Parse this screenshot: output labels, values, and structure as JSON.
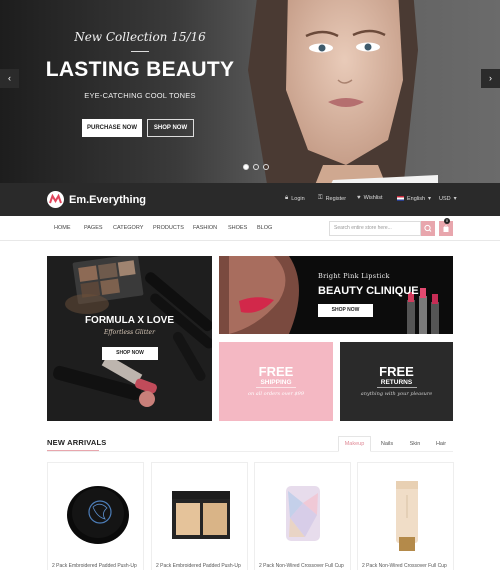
{
  "hero": {
    "subtitle": "New Collection 15/16",
    "title": "LASTING BEAUTY",
    "tagline": "EYE-CATCHING COOL TONES",
    "purchase_label": "PURCHASE NOW",
    "shop_label": "SHOP NOW",
    "prev_arrow": "‹",
    "next_arrow": "›",
    "slides": 3,
    "active_slide": 1
  },
  "topbar": {
    "brand": "Em.Everything",
    "login": "Login",
    "register": "Register",
    "wishlist": "Wishlist",
    "language": "English",
    "currency": "USD"
  },
  "nav": {
    "items": [
      "HOME",
      "PAGES",
      "CATEGORY",
      "PRODUCTS",
      "FASHION",
      "SHOES",
      "BLOG"
    ],
    "search_placeholder": "Search entire store here...",
    "cart_count": "0"
  },
  "banners": {
    "formula": {
      "title": "FORMULA X LOVE",
      "subtitle": "Effortless Glitter",
      "button": "SHOP NOW"
    },
    "lipstick": {
      "subtitle": "Bright Pink Lipstick",
      "title": "BEAUTY CLINIQUE",
      "button": "SHOP NOW"
    },
    "shipping": {
      "title": "FREE",
      "subtitle": "SHIPPING",
      "desc": "on all orders over $99"
    },
    "returns": {
      "title": "FREE",
      "subtitle": "RETURNS",
      "desc": "anything with your pleasure"
    }
  },
  "arrivals": {
    "title": "NEW ARRIVALS",
    "tabs": [
      "Makeup",
      "Nails",
      "Skin",
      "Hair"
    ],
    "active_tab": "Makeup",
    "products": [
      {
        "name": "2 Pack Embroidered Padded Push-Up"
      },
      {
        "name": "2 Pack Embroidered Padded Push-Up"
      },
      {
        "name": "2 Pack Non-Wired Crossover Full Cup"
      },
      {
        "name": "2 Pack Non-Wired Crossover Full Cup"
      }
    ]
  },
  "colors": {
    "accent": "#e8a6ad",
    "dark": "#2a2a2a",
    "pink_banner": "#f4b8c3"
  },
  "icons": {
    "login": "lock-icon",
    "register": "key-icon",
    "wishlist": "heart-icon",
    "flag": "flag-icon",
    "search": "search-icon",
    "cart": "cart-icon"
  }
}
